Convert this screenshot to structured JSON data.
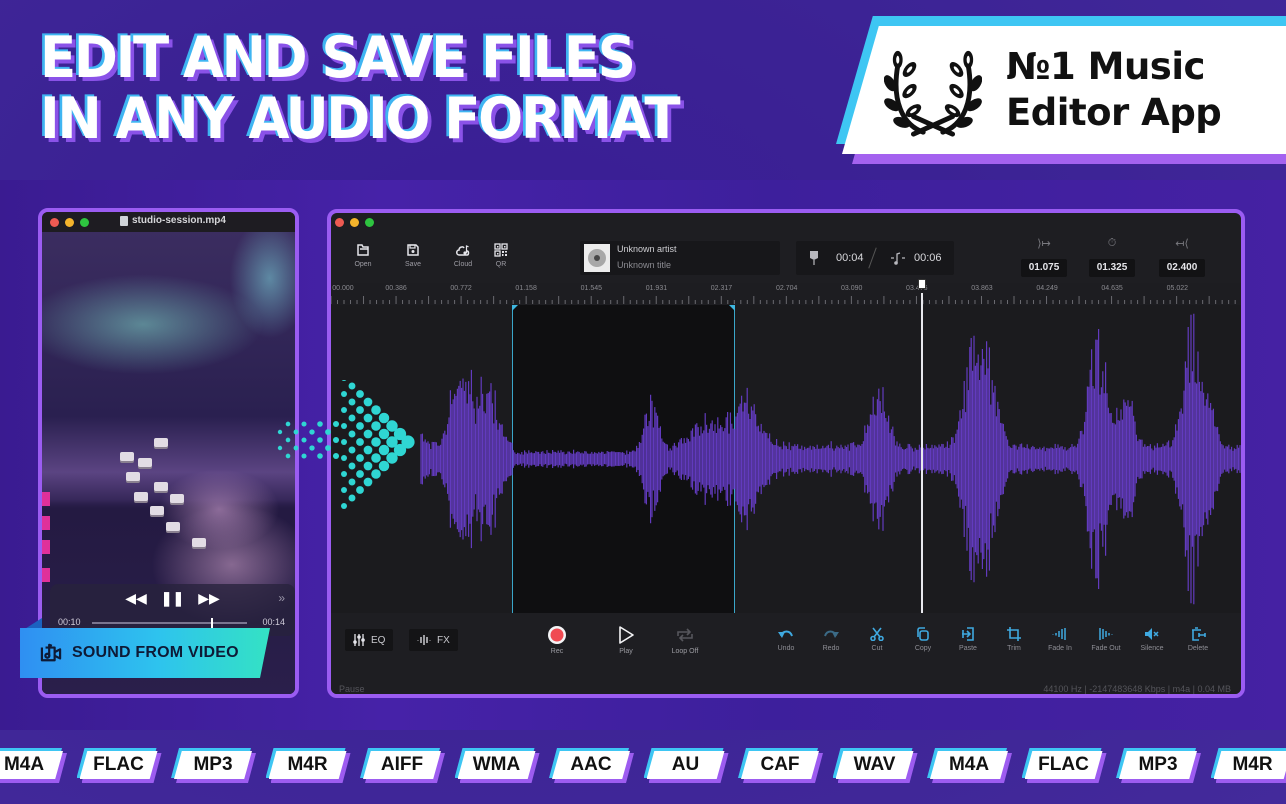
{
  "headline": {
    "line1": "EDIT AND SAVE FILES",
    "line2": "IN ANY AUDIO FORMAT"
  },
  "award": {
    "icon": "laurel-wreath-icon",
    "line1": "№1 Music",
    "line2": "Editor App"
  },
  "colors": {
    "background": "#3f259c",
    "accent_purple": "#9b5cf2",
    "accent_blue": "#3ec6f3",
    "waveform": "#6a3fd0",
    "selection_handle": "#3fb7e0",
    "dots": "#2fd6d3",
    "edit_tool_blue": "#3fa9e0",
    "rec_red": "#f04a52"
  },
  "video_window": {
    "title": "studio-session.mp4",
    "player": {
      "current_time": "00:10",
      "total_time": "00:14",
      "progress": 0.77,
      "controls": [
        "rewind",
        "pause",
        "fast-forward"
      ],
      "skip_icon": "»"
    }
  },
  "sound_badge": {
    "label": "SOUND FROM VIDEO",
    "icon": "video-music-icon"
  },
  "editor": {
    "toolbar": [
      {
        "label": "Open",
        "icon": "folder-open-icon"
      },
      {
        "label": "Save",
        "icon": "floppy-disk-icon"
      },
      {
        "label": "Cloud",
        "icon": "cloud-music-icon"
      },
      {
        "label": "QR",
        "icon": "qr-code-icon"
      }
    ],
    "track": {
      "artist": "Unknown artist",
      "title": "Unknown title"
    },
    "time": {
      "position": "00:04",
      "duration": "00:06"
    },
    "selection": {
      "start": "01.075",
      "length": "01.325",
      "end": "02.400"
    },
    "ruler_labels": [
      "00.000",
      "00.386",
      "00.772",
      "01.158",
      "01.545",
      "01.931",
      "02.317",
      "02.704",
      "03.090",
      "03.476",
      "03.863",
      "04.249",
      "04.635",
      "05.022"
    ],
    "ruler_range": [
      0,
      5.4
    ],
    "selection_range_seconds": [
      1.075,
      2.4
    ],
    "playhead_seconds": 3.5,
    "bottom": {
      "eq_label": "EQ",
      "fx_label": "FX",
      "transport": [
        {
          "label": "Rec",
          "icon": "record-icon"
        },
        {
          "label": "Play",
          "icon": "play-icon"
        },
        {
          "label": "Loop Off",
          "icon": "loop-icon"
        }
      ],
      "edit_tools": [
        {
          "label": "Undo",
          "icon": "undo-icon"
        },
        {
          "label": "Redo",
          "icon": "redo-icon"
        },
        {
          "label": "Cut",
          "icon": "scissors-icon"
        },
        {
          "label": "Copy",
          "icon": "copy-icon"
        },
        {
          "label": "Paste",
          "icon": "paste-icon"
        },
        {
          "label": "Trim",
          "icon": "crop-icon"
        },
        {
          "label": "Fade In",
          "icon": "fade-in-icon"
        },
        {
          "label": "Fade Out",
          "icon": "fade-out-icon"
        },
        {
          "label": "Silence",
          "icon": "mute-icon"
        },
        {
          "label": "Delete",
          "icon": "delete-icon"
        }
      ]
    },
    "status": {
      "state": "Pause",
      "info": "44100 Hz  |  -2147483648 Kbps  |  m4a  |  0.04 MB"
    }
  },
  "formats": [
    "M4A",
    "FLAC",
    "MP3",
    "M4R",
    "AIFF",
    "WMA",
    "AAC",
    "AU",
    "CAF",
    "WAV",
    "M4A",
    "FLAC",
    "MP3",
    "M4R"
  ]
}
